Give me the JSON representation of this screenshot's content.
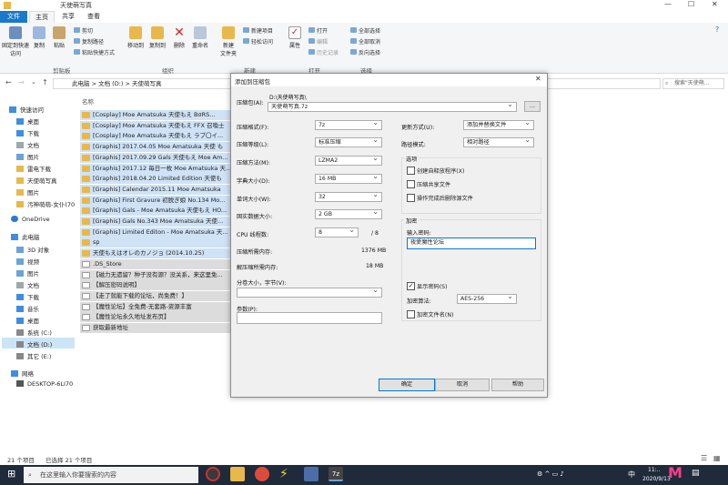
{
  "window": {
    "title": "天使萌写真",
    "menu_tabs": [
      "文件",
      "主页",
      "共享",
      "查看"
    ]
  },
  "ribbon": {
    "clipboard": {
      "pin": "固定到快速访问",
      "copy": "复制",
      "paste": "粘贴",
      "cut": "剪切",
      "copy_path": "复制路径",
      "paste_shortcut": "粘贴快捷方式",
      "group": "剪贴板"
    },
    "organize": {
      "move_to": "移动到",
      "copy_to": "复制到",
      "delete": "删除",
      "rename": "重命名",
      "group": "组织"
    },
    "new": {
      "new_folder": "新建\n文件夹",
      "new_item": "新建项目",
      "easy_access": "轻松访问",
      "group": "新建"
    },
    "open": {
      "properties": "属性",
      "open": "打开",
      "edit": "编辑",
      "history": "历史记录",
      "group": "打开"
    },
    "select": {
      "select_all": "全部选择",
      "select_none": "全部取消",
      "invert": "反向选择",
      "group": "选择"
    }
  },
  "address": {
    "path": [
      "此电脑",
      "文档 (D:)",
      "天使萌写真"
    ],
    "search_placeholder": "搜索\"天使萌..."
  },
  "nav": {
    "quick_access": "快速访问",
    "items": [
      "桌面",
      "下载",
      "文档",
      "图片",
      "雷电下载",
      "天使萌写真",
      "图片",
      "污神萌萌-女仆(70"
    ],
    "onedrive": "OneDrive",
    "this_pc": "此电脑",
    "pc_items": [
      "3D 对象",
      "视频",
      "图片",
      "文档",
      "下载",
      "音乐",
      "桌面",
      "系统 (C:)",
      "文档 (D:)",
      "其它 (E:)"
    ],
    "network": "网络",
    "network_items": [
      "DESKTOP-6LI70"
    ]
  },
  "files": {
    "column_name": "名称",
    "rows": [
      {
        "name": "[Cosplay] Moe Amatsuka 天使もえ BσRS...",
        "type": "folder"
      },
      {
        "name": "[Cosplay] Moe Amatsuka 天使もえ FFX 召喚士",
        "type": "folder"
      },
      {
        "name": "[Cosplay] Moe Amatsuka 天使もえ ラブ〇イ...",
        "type": "folder"
      },
      {
        "name": "[Graphis] 2017.04.05 Moe Amatsuka 天使 も",
        "type": "folder"
      },
      {
        "name": "[Graphis] 2017.09.29 Gals 天使もえ Moe Am...",
        "type": "folder"
      },
      {
        "name": "[Graphis] 2017.12 毎日一枚 Moe Amatsuka 天...",
        "type": "folder"
      },
      {
        "name": "[Graphis] 2018.04.20 Limited Edition 天使も",
        "type": "folder"
      },
      {
        "name": "[Graphis] Calendar 2015.11 Moe Amatsuka",
        "type": "folder"
      },
      {
        "name": "[Graphis] First Gravure 初脱ぎ娘 No.134 Mo...",
        "type": "folder"
      },
      {
        "name": "[Graphis] Gals - Moe Amatsuka 天使もえ HO...",
        "type": "folder"
      },
      {
        "name": "[Graphis] Gals No.343 Moe Amatsuka 天使...",
        "type": "folder"
      },
      {
        "name": "[Graphis] Limited Editon - Moe Amatsuka 天...",
        "type": "folder"
      },
      {
        "name": "sp",
        "type": "folder"
      },
      {
        "name": "天使もえはオレのカノジョ (2014.10.25)",
        "type": "folder"
      },
      {
        "name": ".DS_Store",
        "type": "doc"
      },
      {
        "name": "【磁力无遗留？种子没有源？没关系，来这里免...",
        "type": "doc"
      },
      {
        "name": "【解压密码说明】",
        "type": "doc"
      },
      {
        "name": "【走了就能下载的论坛，尚免费！】",
        "type": "doc"
      },
      {
        "name": "【魔性论坛】全免费-无套路-资源丰富",
        "type": "doc"
      },
      {
        "name": "【魔性论坛永久地址发布页】",
        "type": "doc"
      },
      {
        "name": "获取最新地址",
        "type": "doc"
      }
    ]
  },
  "status": {
    "count": "21 个项目",
    "selected": "已选择 21 个项目"
  },
  "dialog": {
    "title": "添加到压缩包",
    "archive_label": "压缩包(A):",
    "archive_dir": "D:\\天使萌写真\\",
    "archive_name": "天使萌写真.7z",
    "browse": "...",
    "format_label": "压缩格式(F):",
    "format": "7z",
    "level_label": "压缩等级(L):",
    "level": "标准压缩",
    "method_label": "压缩方法(M):",
    "method": "LZMA2",
    "dict_label": "字典大小(D):",
    "dict": "16 MB",
    "word_label": "单词大小(W):",
    "word": "32",
    "solid_label": "固实数据大小:",
    "solid": "2 GB",
    "threads_label": "CPU 线程数:",
    "threads": "8",
    "threads_total": "/ 8",
    "mem_comp_label": "压缩所需内存:",
    "mem_comp": "1376 MB",
    "mem_decomp_label": "解压缩所需内存:",
    "mem_decomp": "18 MB",
    "split_label": "分卷大小，字节(V):",
    "params_label": "参数(P):",
    "update_label": "更新方式(U):",
    "update": "添加并替换文件",
    "path_label": "路径模式:",
    "path": "相对路径",
    "options_title": "选项",
    "opt_sfx": "创建自释放程序(X)",
    "opt_shared": "压缩共享文件",
    "opt_delete": "操作完成后删除源文件",
    "encrypt_title": "加密",
    "password_label": "输入密码:",
    "password": "夜愛魔性论坛",
    "show_password": "显示密码(S)",
    "enc_method_label": "加密算法:",
    "enc_method": "AES-256",
    "enc_names": "加密文件名(N)",
    "ok": "确定",
    "cancel": "取消",
    "help": "帮助"
  },
  "taskbar": {
    "search_placeholder": "在这里输入你要搜索的内容",
    "time": "11:..",
    "date": "2020/9/13",
    "ime": "中"
  }
}
